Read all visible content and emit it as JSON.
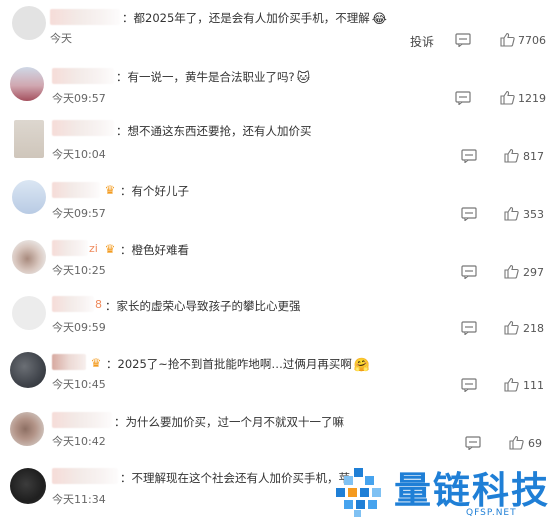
{
  "actions": {
    "report_label": "投诉"
  },
  "comments": [
    {
      "name_suffix": "",
      "vip": false,
      "text": "：都2025年了，还是会有人加价买手机，不理解",
      "emoji": "😂",
      "time": "今天",
      "likes": "7706",
      "report": true
    },
    {
      "name_suffix": "",
      "vip": false,
      "text": "：有一说一，黄牛是合法职业了吗?",
      "emoji": "🐱",
      "time": "今天09:57",
      "likes": "1219"
    },
    {
      "name_suffix": "",
      "vip": false,
      "text": "：想不通这东西还要抢，还有人加价买",
      "emoji": "",
      "time": "今天10:04",
      "likes": "817"
    },
    {
      "name_suffix": "",
      "vip": true,
      "text": "：有个好儿子",
      "emoji": "",
      "time": "今天09:57",
      "likes": "353"
    },
    {
      "name_suffix": "zi",
      "vip": true,
      "text": "：橙色好难看",
      "emoji": "",
      "time": "今天10:25",
      "likes": "297"
    },
    {
      "name_suffix": "8",
      "vip": false,
      "text": "：家长的虚荣心导致孩子的攀比心更强",
      "emoji": "",
      "time": "今天09:59",
      "likes": "218"
    },
    {
      "name_suffix": "",
      "vip": true,
      "text": "：2025了~抢不到首批能咋地啊…过俩月再买啊",
      "emoji": "🤗",
      "time": "今天10:45",
      "likes": "111"
    },
    {
      "name_suffix": "",
      "vip": false,
      "text": "：为什么要加价买，过一个月不就双十一了嘛",
      "emoji": "",
      "time": "今天10:42",
      "likes": "69"
    },
    {
      "name_suffix": "",
      "vip": false,
      "text": "：不理解现在这个社会还有人加价买手机，苹",
      "emoji": "",
      "time": "今天11:34",
      "likes": ""
    }
  ],
  "watermark": {
    "title": "量链科技",
    "subtitle": "QFSP.NET"
  },
  "colors": {
    "brand": "#1f7fd6",
    "text": "#333333",
    "meta": "#666666"
  }
}
